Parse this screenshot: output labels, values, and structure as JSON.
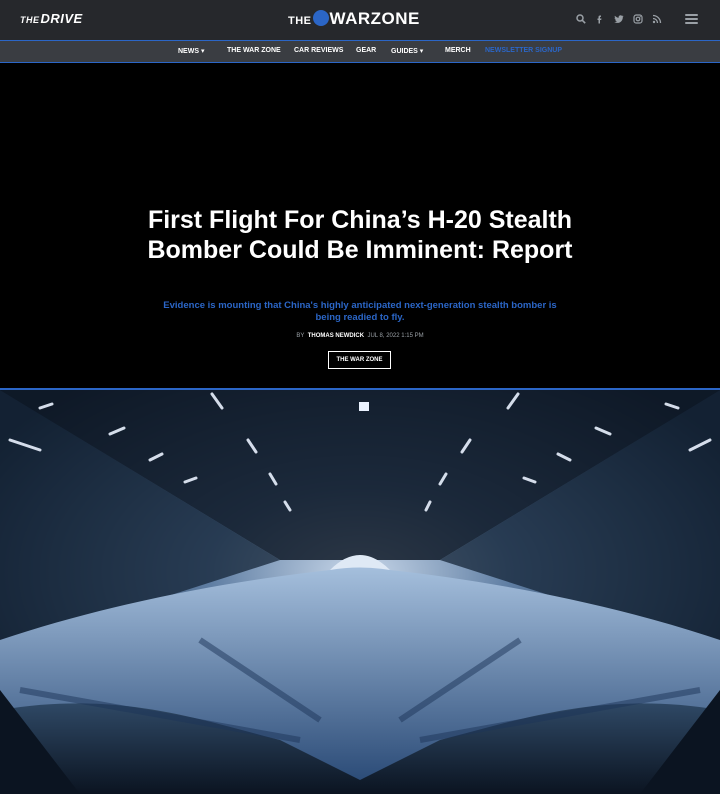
{
  "header": {
    "drive_logo": {
      "the": "THE",
      "name": "DRIVE"
    },
    "warzone_logo": {
      "the": "THE",
      "name": "WARZONE"
    },
    "icons": [
      "search-icon",
      "facebook-icon",
      "twitter-icon",
      "instagram-icon",
      "rss-icon",
      "menu-icon"
    ]
  },
  "nav": {
    "items": [
      "NEWS ▾",
      "THE WAR ZONE",
      "CAR REVIEWS",
      "GEAR",
      "GUIDES ▾",
      "MERCH",
      "NEWSLETTER SIGNUP"
    ]
  },
  "article": {
    "title": "First Flight For China’s H-20 Stealth Bomber Could Be Imminent: Report",
    "dek": "Evidence is mounting that China's highly anticipated next-generation stealth bomber is being readied to fly.",
    "by": "BY",
    "author": "THOMAS NEWDICK",
    "date": "JUL 8, 2022 1:15 PM",
    "tag": "THE WAR ZONE"
  },
  "colors": {
    "accent": "#2b66c7",
    "header_bg": "#26282c",
    "nav_bg": "#3a3d42"
  }
}
